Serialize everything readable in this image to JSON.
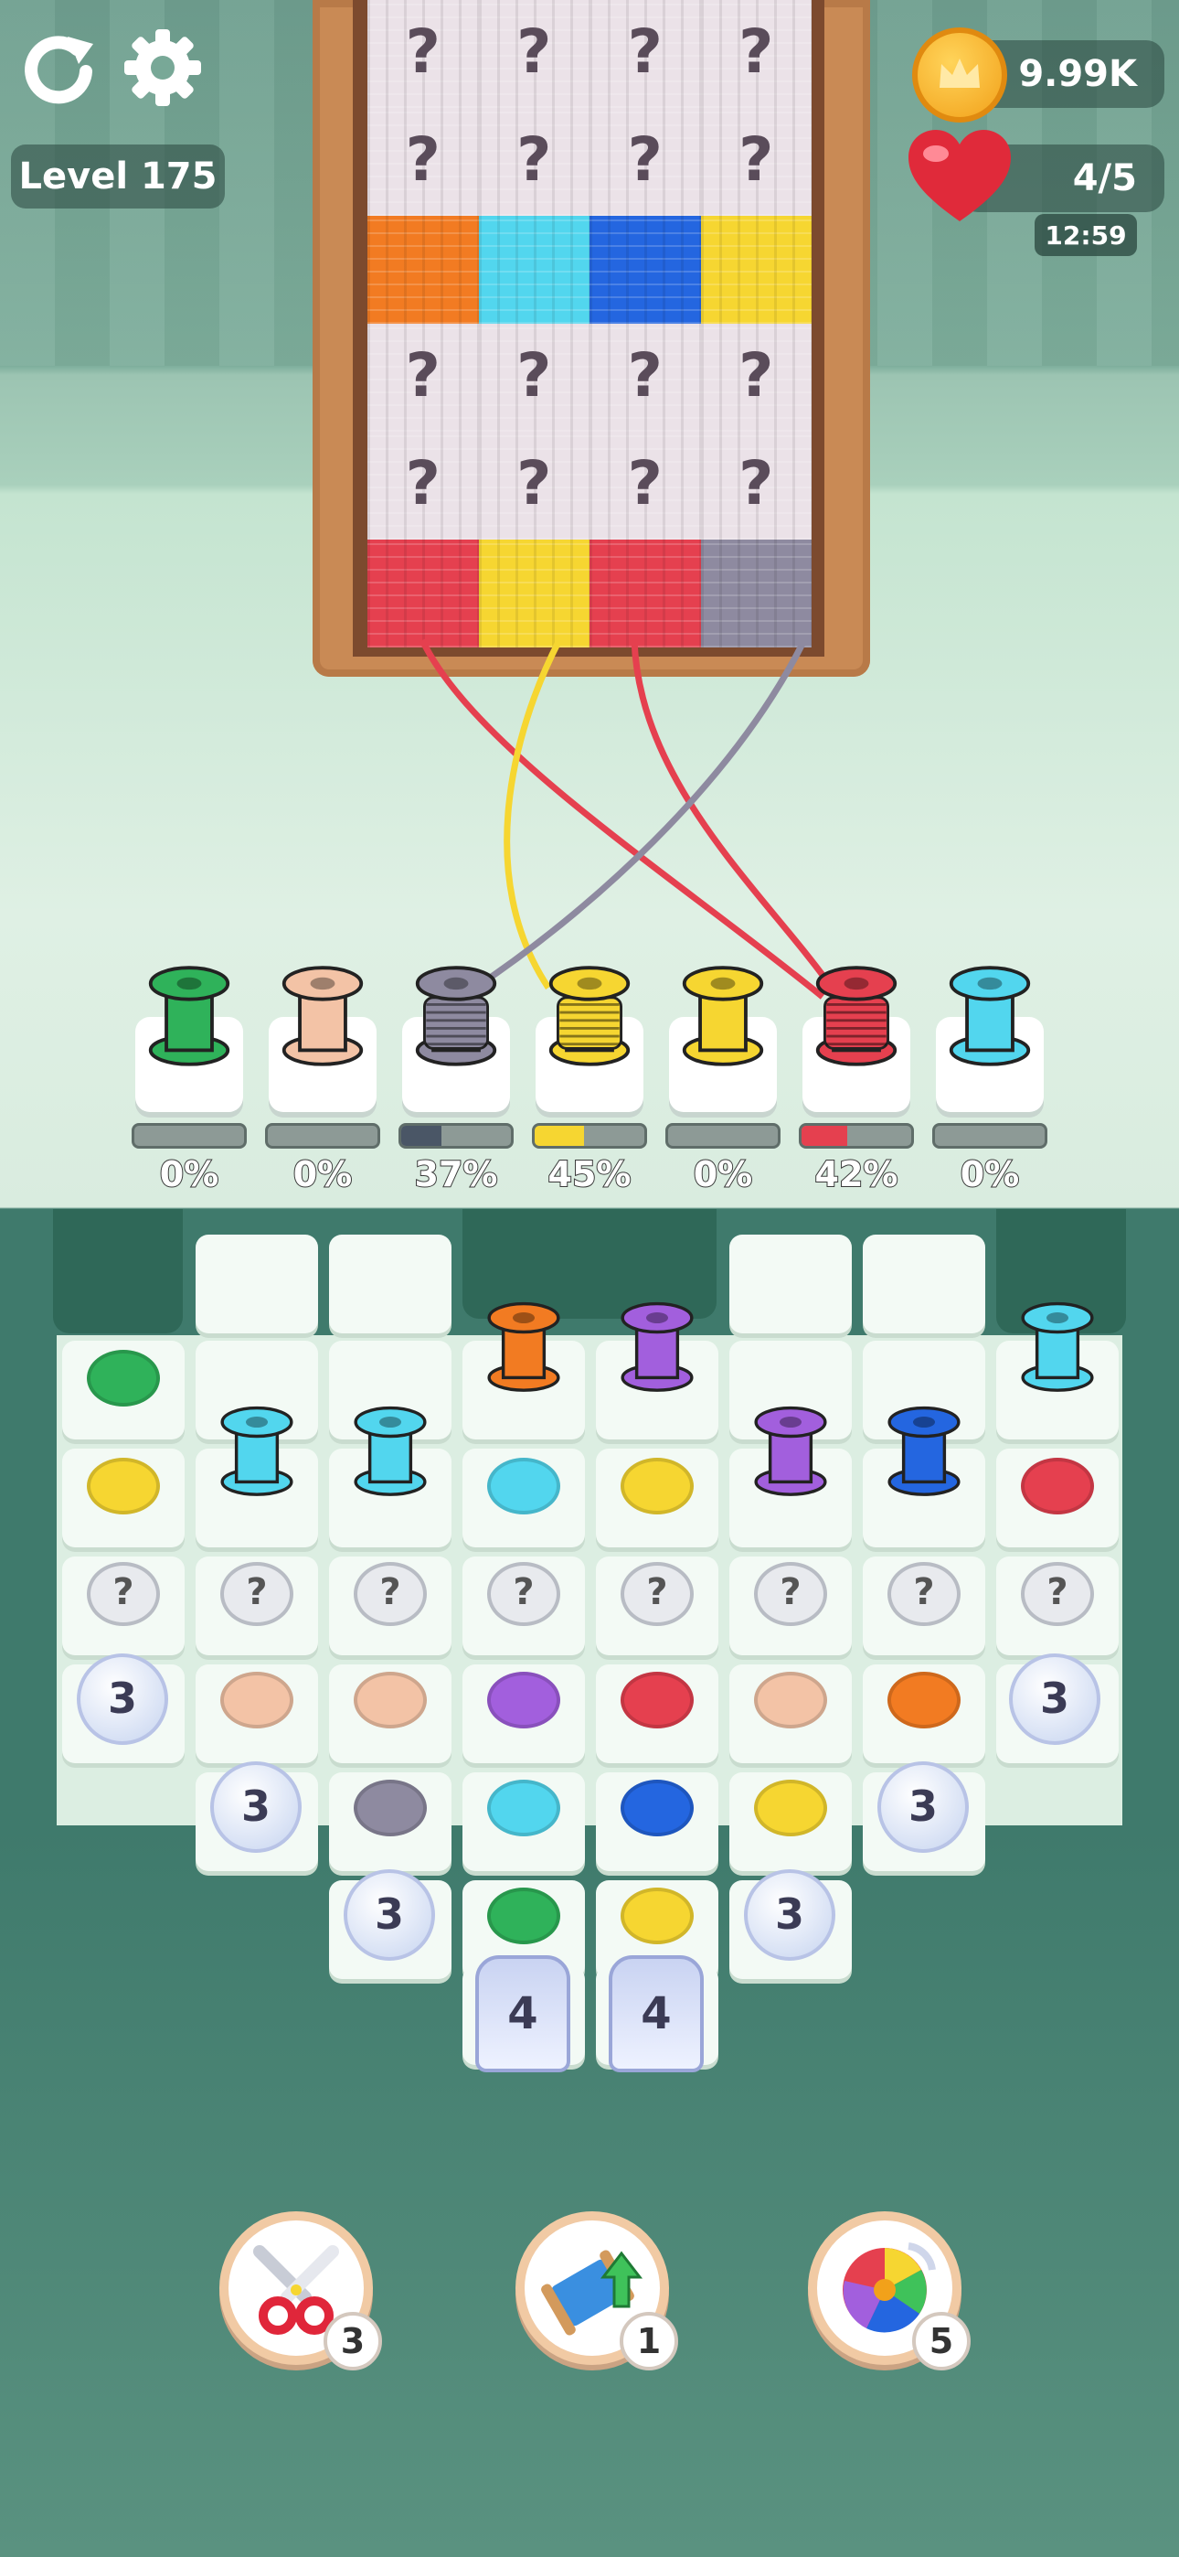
{
  "hud": {
    "level_label": "Level 175",
    "coins": "9.99K",
    "lives": "4/5",
    "life_timer": "12:59"
  },
  "colors": {
    "green": "#2fb25a",
    "peach": "#f3c3a6",
    "gray": "#8e8aa0",
    "yellow": "#f6d631",
    "red": "#e5404f",
    "cyan": "#52d6ee",
    "orange": "#f27b22",
    "purple": "#a25fdd",
    "blue": "#2466e0"
  },
  "cloth_rows": [
    [
      "hidden",
      "hidden",
      "hidden",
      "hidden"
    ],
    [
      "hidden",
      "hidden",
      "hidden",
      "hidden"
    ],
    [
      "orange",
      "cyan",
      "blue",
      "yellow"
    ],
    [
      "hidden",
      "hidden",
      "hidden",
      "hidden"
    ],
    [
      "hidden",
      "hidden",
      "hidden",
      "hidden"
    ],
    [
      "red",
      "yellow",
      "red",
      "gray"
    ]
  ],
  "hidden_mark": "?",
  "active_spools": [
    {
      "color": "green",
      "progress": "0%",
      "fill": 0.0
    },
    {
      "color": "peach",
      "progress": "0%",
      "fill": 0.0
    },
    {
      "color": "gray",
      "progress": "37%",
      "fill": 0.37
    },
    {
      "color": "yellow",
      "progress": "45%",
      "fill": 0.45
    },
    {
      "color": "yellow",
      "progress": "0%",
      "fill": 0.0
    },
    {
      "color": "red",
      "progress": "42%",
      "fill": 0.42
    },
    {
      "color": "cyan",
      "progress": "0%",
      "fill": 0.0
    }
  ],
  "board": {
    "standing_spools": [
      "orange",
      "purple",
      "cyan",
      "cyan",
      "purple",
      "blue",
      "cyan"
    ],
    "discs": [
      "green",
      "yellow",
      "cyan",
      "yellow",
      "red",
      "peach",
      "peach",
      "purple",
      "red",
      "peach",
      "orange",
      "gray",
      "cyan",
      "blue",
      "yellow",
      "green",
      "yellow"
    ],
    "hidden_mark": "?",
    "locks": [
      {
        "count": "3"
      },
      {
        "count": "3"
      },
      {
        "count": "3"
      },
      {
        "count": "3"
      },
      {
        "count": "3"
      },
      {
        "count": "3"
      }
    ],
    "tall_locks": [
      {
        "count": "4"
      },
      {
        "count": "4"
      }
    ]
  },
  "boosters": [
    {
      "name": "scissors",
      "count": "3"
    },
    {
      "name": "spool-upgrade",
      "count": "1"
    },
    {
      "name": "color-wheel",
      "count": "5"
    }
  ]
}
